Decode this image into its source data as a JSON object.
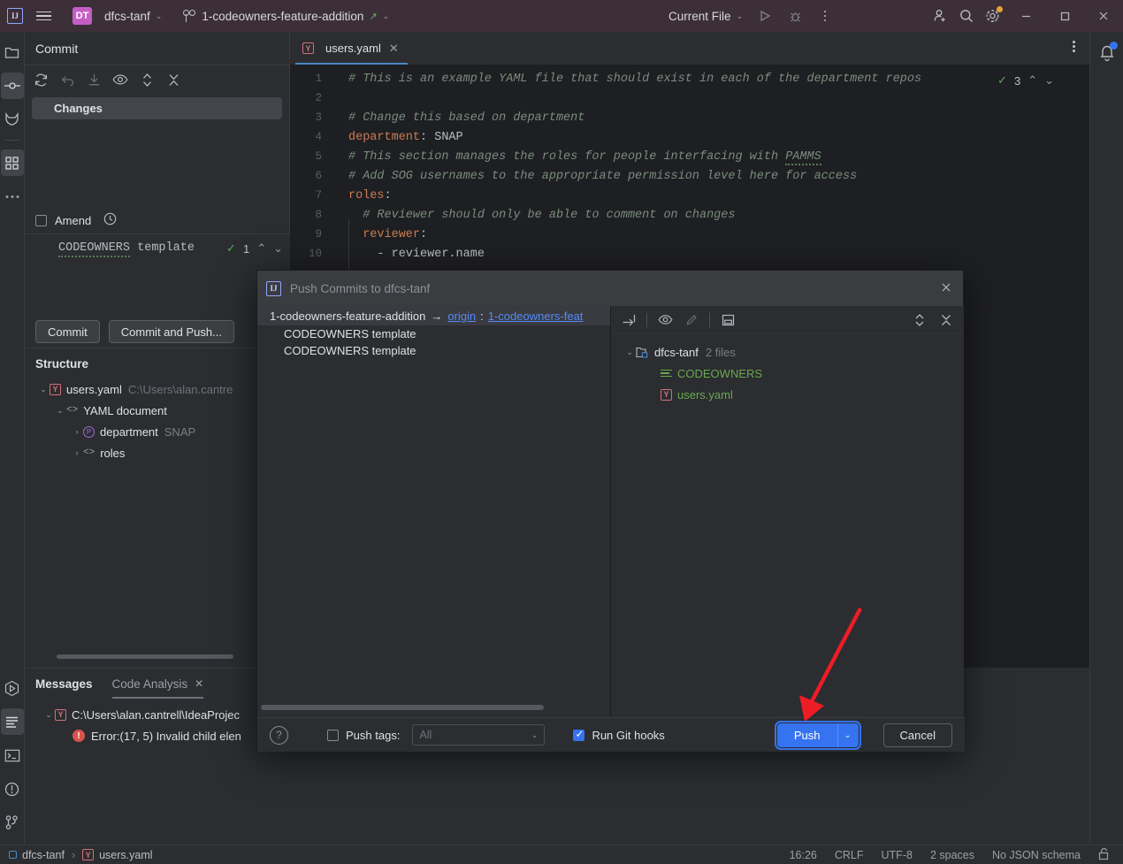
{
  "titlebar": {
    "menu_icon": "hamburger-menu-icon",
    "project_initials": "DT",
    "project_name": "dfcs-tanf",
    "branch_name": "1-codeowners-feature-addition",
    "run_config": "Current File",
    "icons": [
      "run-icon",
      "debug-icon",
      "more-actions-icon",
      "add-collaborator-icon",
      "search-icon",
      "settings-icon"
    ],
    "window_controls": [
      "minimize",
      "maximize",
      "close"
    ]
  },
  "rail": {
    "top_items": [
      {
        "name": "project-icon",
        "label": "Project"
      },
      {
        "name": "commit-icon",
        "label": "Commit",
        "active": true
      },
      {
        "name": "gitlab-icon",
        "label": "GitLab"
      },
      {
        "name": "structure-icon",
        "label": "Structure",
        "active": true
      },
      {
        "name": "more-tool-windows-icon",
        "label": "More"
      }
    ],
    "bottom_items": [
      {
        "name": "run-tool-icon",
        "label": "Run"
      },
      {
        "name": "messages-tool-icon",
        "label": "Messages",
        "active": true
      },
      {
        "name": "terminal-icon",
        "label": "Terminal"
      },
      {
        "name": "problems-icon",
        "label": "Problems"
      },
      {
        "name": "git-icon",
        "label": "Git"
      }
    ]
  },
  "commit": {
    "title": "Commit",
    "toolbar_icons": [
      "refresh-icon",
      "rollback-icon",
      "update-icon",
      "show-diff-icon",
      "expand-collapse-icon",
      "collapse-all-icon"
    ],
    "changes_node": "Changes",
    "amend_label": "Amend",
    "amend_checked": false,
    "history_icon": "history-icon",
    "message": "CODEOWNERS template",
    "inspection_count": "1",
    "commit_button": "Commit",
    "commit_and_push_button": "Commit and Push..."
  },
  "structure": {
    "title": "Structure",
    "rows": [
      {
        "indent": 0,
        "twisty": "v",
        "icon": "yaml-file-icon",
        "label": "users.yaml",
        "path": "C:\\Users\\alan.cantre"
      },
      {
        "indent": 1,
        "twisty": "v",
        "icon": "angle-brackets-icon",
        "label": "YAML document",
        "path": ""
      },
      {
        "indent": 2,
        "twisty": ">",
        "icon": "property-icon",
        "label": "department",
        "value": "SNAP"
      },
      {
        "indent": 2,
        "twisty": ">",
        "icon": "angle-brackets-icon",
        "label": "roles",
        "value": ""
      }
    ]
  },
  "editor": {
    "tab_name": "users.yaml",
    "tab_icon": "yaml-file-icon",
    "close_icon": "close-icon",
    "kebab_icon": "more-actions-icon",
    "inspection_count": "3",
    "inspection_icon": "inspections-ok-icon",
    "lines": [
      {
        "num": "1",
        "segments": [
          {
            "t": "# This is an example YAML file that should exist in each of the department repos",
            "c": "cm"
          }
        ]
      },
      {
        "num": "2",
        "segments": []
      },
      {
        "num": "3",
        "segments": [
          {
            "t": "# Change this based on department",
            "c": "cm"
          }
        ]
      },
      {
        "num": "4",
        "segments": [
          {
            "t": "department",
            "c": "key"
          },
          {
            "t": ": ",
            "c": "punc"
          },
          {
            "t": "SNAP",
            "c": "val"
          }
        ]
      },
      {
        "num": "5",
        "segments": [
          {
            "t": "# This section manages the roles for people interfacing with ",
            "c": "cm"
          },
          {
            "t": "PAMMS",
            "c": "cm typo"
          }
        ]
      },
      {
        "num": "6",
        "segments": [
          {
            "t": "# Add SOG usernames to the appropriate permission level here for access",
            "c": "cm"
          }
        ]
      },
      {
        "num": "7",
        "segments": [
          {
            "t": "roles",
            "c": "key"
          },
          {
            "t": ":",
            "c": "punc"
          }
        ]
      },
      {
        "num": "8",
        "segments": [
          {
            "t": "  # Reviewer should only be able to comment on changes",
            "c": "cm"
          }
        ]
      },
      {
        "num": "9",
        "segments": [
          {
            "t": "  reviewer",
            "c": "key"
          },
          {
            "t": ":",
            "c": "punc"
          }
        ]
      },
      {
        "num": "10",
        "segments": [
          {
            "t": "    - ",
            "c": "punc"
          },
          {
            "t": "reviewer.name",
            "c": "val"
          }
        ]
      }
    ]
  },
  "bottom_panel": {
    "tabs": [
      {
        "label": "Messages",
        "active": true,
        "closable": false
      },
      {
        "label": "Code Analysis",
        "active": false,
        "closable": true
      }
    ],
    "tree": [
      {
        "twisty": "v",
        "icon": "yaml-file-icon",
        "label": "C:\\Users\\alan.cantrell\\IdeaProjec"
      },
      {
        "twisty": "",
        "icon": "error-icon",
        "label": "Error:(17, 5)  Invalid child elen"
      }
    ]
  },
  "statusbar": {
    "breadcrumb_project": "dfcs-tanf",
    "breadcrumb_separator": "›",
    "breadcrumb_file": "users.yaml",
    "time": "16:26",
    "line_separator": "CRLF",
    "encoding": "UTF-8",
    "indent": "2 spaces",
    "schema": "No JSON schema",
    "lock_icon": "unlocked-icon"
  },
  "dialog": {
    "title": "Push Commits to dfcs-tanf",
    "close_icon": "close-icon",
    "branch_local": "1-codeowners-feature-addition",
    "branch_arrow": "→",
    "remote": "origin",
    "remote_sep": ":",
    "branch_remote": "1-codeowners-feat",
    "commits": [
      "CODEOWNERS template",
      "CODEOWNERS template"
    ],
    "right_toolbar_icons": [
      "group-by-icon",
      "show-diff-icon",
      "edit-source-icon",
      "preview-icon",
      "expand-all-icon",
      "collapse-all-icon"
    ],
    "file_tree": [
      {
        "indent": 0,
        "twisty": "v",
        "icon": "folder-module-icon",
        "label": "dfcs-tanf",
        "count": "2 files",
        "color": "normal"
      },
      {
        "indent": 1,
        "twisty": "",
        "icon": "codeowners-file-icon",
        "label": "CODEOWNERS",
        "count": "",
        "color": "green"
      },
      {
        "indent": 1,
        "twisty": "",
        "icon": "yaml-file-icon",
        "label": "users.yaml",
        "count": "",
        "color": "green"
      }
    ],
    "help_icon": "help-icon",
    "push_tags_label": "Push tags:",
    "push_tags_checked": false,
    "push_tags_value": "All",
    "run_git_hooks_label": "Run Git hooks",
    "run_git_hooks_checked": true,
    "push_button": "Push",
    "push_split_icon": "chevron-down-icon",
    "cancel_button": "Cancel"
  },
  "annotation": {
    "arrow_color": "#ee1c25",
    "points_to": "push-button"
  },
  "colors": {
    "accent_blue": "#3573f0",
    "titlebar_bg": "#3c2f38",
    "panel_bg": "#2b2d30",
    "editor_bg": "#1e1f22",
    "green": "#6aa84f",
    "comment": "#7a8c7d",
    "key": "#cb7c54"
  }
}
